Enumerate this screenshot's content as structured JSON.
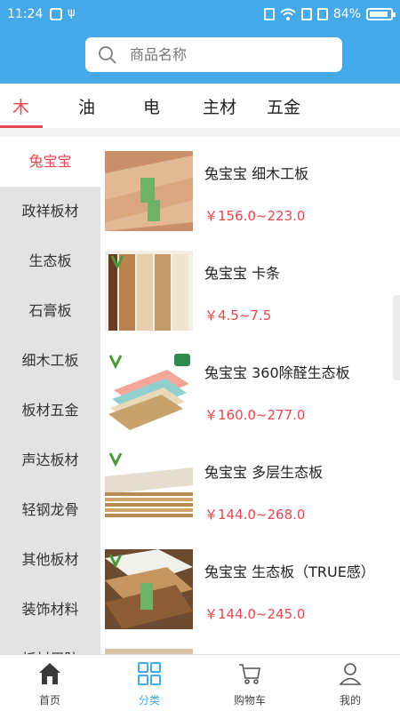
{
  "status": {
    "time": "11:24",
    "usb_icon": "usb-icon",
    "battery": "84%"
  },
  "search": {
    "placeholder": "商品名称"
  },
  "tabs": [
    {
      "label": "木",
      "active": true
    },
    {
      "label": "油"
    },
    {
      "label": "电"
    },
    {
      "label": "主材"
    },
    {
      "label": "五金"
    }
  ],
  "sidebar": {
    "items": [
      {
        "label": "兔宝宝",
        "active": true
      },
      {
        "label": "政祥板材"
      },
      {
        "label": "生态板"
      },
      {
        "label": "石膏板"
      },
      {
        "label": "细木工板"
      },
      {
        "label": "板材五金"
      },
      {
        "label": "声达板材"
      },
      {
        "label": "轻钢龙骨"
      },
      {
        "label": "其他板材"
      },
      {
        "label": "装饰材料"
      },
      {
        "label": "板材周防"
      }
    ]
  },
  "products": [
    {
      "name": "兔宝宝 细木工板",
      "price": "￥156.0~223.0"
    },
    {
      "name": "兔宝宝 卡条",
      "price": "￥4.5~7.5"
    },
    {
      "name": "兔宝宝 360除醛生态板",
      "price": "￥160.0~277.0"
    },
    {
      "name": "兔宝宝 多层生态板",
      "price": "￥144.0~268.0"
    },
    {
      "name": "兔宝宝 生态板（TRUE感）",
      "price": "￥144.0~245.0"
    }
  ],
  "bottomnav": [
    {
      "label": "首页",
      "icon": "home-icon"
    },
    {
      "label": "分类",
      "icon": "category-icon",
      "active": true
    },
    {
      "label": "购物车",
      "icon": "cart-icon"
    },
    {
      "label": "我的",
      "icon": "user-icon"
    }
  ],
  "colors": {
    "header": "#45a8e8",
    "accent": "#e5474f",
    "sidebar_bg": "#e3e3e3"
  }
}
